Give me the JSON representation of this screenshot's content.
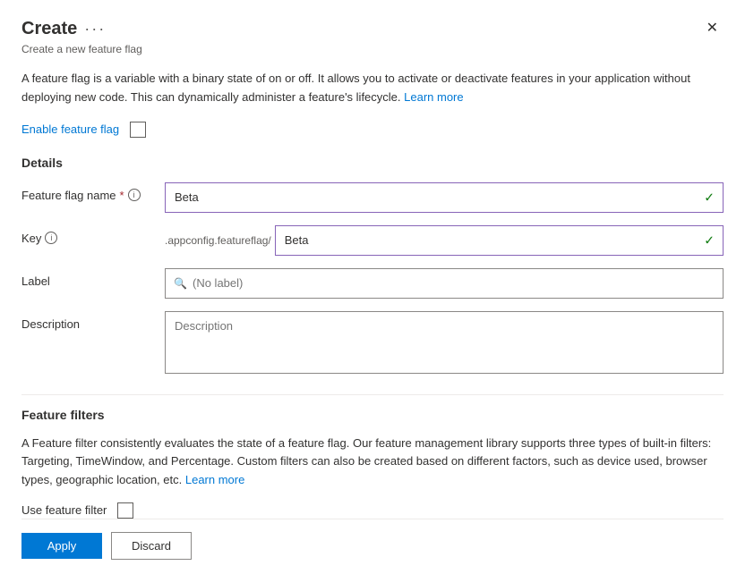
{
  "panel": {
    "title": "Create",
    "subtitle": "Create a new feature flag",
    "close_label": "✕",
    "more_icon": "···"
  },
  "description": {
    "text_part1": "A feature flag is a variable with a binary state of on or off. It allows you to activate or deactivate features in your application without deploying new code. This can dynamically administer a feature's lifecycle.",
    "link_text": "Learn more",
    "link_url": "#"
  },
  "enable": {
    "label": "Enable feature flag"
  },
  "details": {
    "section_title": "Details",
    "feature_flag_name": {
      "label": "Feature flag name",
      "required": "*",
      "value": "Beta",
      "placeholder": ""
    },
    "key": {
      "label": "Key",
      "prefix": ".appconfig.featureflag/",
      "value": "Beta",
      "placeholder": ""
    },
    "label_field": {
      "label": "Label",
      "placeholder": "(No label)"
    },
    "description_field": {
      "label": "Description",
      "placeholder": "Description"
    }
  },
  "feature_filters": {
    "section_title": "Feature filters",
    "description_part1": "A Feature filter consistently evaluates the state of a feature flag. Our feature management library supports three types of built-in filters: Targeting, TimeWindow, and Percentage. Custom filters can also be created based on different factors, such as device used, browser types, geographic location, etc.",
    "link_text": "Learn more",
    "link_url": "#",
    "use_filter_label": "Use feature filter"
  },
  "footer": {
    "apply_label": "Apply",
    "discard_label": "Discard"
  },
  "icons": {
    "close": "✕",
    "check": "✓",
    "info": "i",
    "search": "🔍",
    "more": "···"
  }
}
